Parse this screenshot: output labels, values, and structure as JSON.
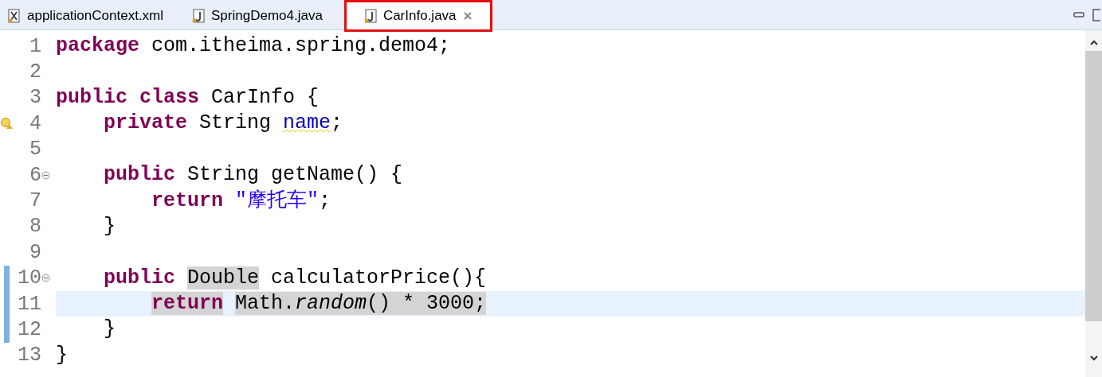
{
  "tabs": [
    {
      "label": "applicationContext.xml",
      "kind": "xml",
      "selected": false,
      "closable": false
    },
    {
      "label": "SpringDemo4.java",
      "kind": "java",
      "selected": false,
      "closable": false
    },
    {
      "label": "CarInfo.java",
      "kind": "java",
      "selected": true,
      "closable": true
    }
  ],
  "lines": [
    {
      "number": "1",
      "current": false,
      "changed": false,
      "warning": false,
      "foldable": false,
      "tokens": [
        {
          "kind": "keyword",
          "text": "package",
          "highlighted": false
        },
        {
          "kind": "plain",
          "text": " com.itheima.spring.demo4;",
          "highlighted": false
        }
      ]
    },
    {
      "number": "2",
      "current": false,
      "changed": false,
      "warning": false,
      "foldable": false
    },
    {
      "number": "3",
      "current": false,
      "changed": false,
      "warning": false,
      "foldable": false,
      "tokens": [
        {
          "kind": "keyword",
          "text": "public class",
          "highlighted": false
        },
        {
          "kind": "plain",
          "text": " CarInfo {",
          "highlighted": false
        }
      ]
    },
    {
      "number": "4",
      "current": false,
      "changed": false,
      "warning": true,
      "foldable": false,
      "tokens": [
        {
          "kind": "keyword",
          "text": "    private",
          "highlighted": false
        },
        {
          "kind": "plain",
          "text": " String ",
          "highlighted": false
        },
        {
          "kind": "field",
          "text": "name",
          "highlighted": false
        },
        {
          "kind": "plain",
          "text": ";",
          "highlighted": false
        }
      ]
    },
    {
      "number": "5",
      "current": false,
      "changed": false,
      "warning": false,
      "foldable": false
    },
    {
      "number": "6",
      "current": false,
      "changed": false,
      "warning": false,
      "foldable": true,
      "tokens": [
        {
          "kind": "keyword",
          "text": "    public",
          "highlighted": false
        },
        {
          "kind": "plain",
          "text": " String getName() {",
          "highlighted": false
        }
      ]
    },
    {
      "number": "7",
      "current": false,
      "changed": false,
      "warning": false,
      "foldable": false,
      "tokens": [
        {
          "kind": "keyword",
          "text": "        return",
          "highlighted": false
        },
        {
          "kind": "string",
          "text": " \"摩托车\"",
          "highlighted": false
        },
        {
          "kind": "plain",
          "text": ";",
          "highlighted": false
        }
      ]
    },
    {
      "number": "8",
      "current": false,
      "changed": false,
      "warning": false,
      "foldable": false,
      "tokens": [
        {
          "kind": "plain",
          "text": "    }",
          "highlighted": false
        }
      ]
    },
    {
      "number": "9",
      "current": false,
      "changed": false,
      "warning": false,
      "foldable": false
    },
    {
      "number": "10",
      "current": false,
      "changed": true,
      "warning": false,
      "foldable": true,
      "tokens": [
        {
          "kind": "keyword",
          "text": "    public",
          "highlighted": false
        },
        {
          "kind": "plain",
          "text": " Double",
          "highlighted": true
        },
        {
          "kind": "plain",
          "text": " calculatorPrice(){",
          "highlighted": false
        }
      ]
    },
    {
      "number": "11",
      "current": true,
      "changed": true,
      "warning": false,
      "foldable": false,
      "tokens": [
        {
          "kind": "keyword",
          "text": "        return",
          "highlighted": true
        },
        {
          "kind": "plain",
          "text": " Math.",
          "highlighted": true
        },
        {
          "kind": "italic",
          "text": "random",
          "highlighted": true
        },
        {
          "kind": "plain",
          "text": "() * 3000;",
          "highlighted": true
        }
      ]
    },
    {
      "number": "12",
      "current": false,
      "changed": true,
      "warning": false,
      "foldable": false,
      "tokens": [
        {
          "kind": "plain",
          "text": "    }",
          "highlighted": false
        }
      ]
    },
    {
      "number": "13",
      "current": false,
      "changed": false,
      "warning": false,
      "foldable": false,
      "tokens": [
        {
          "kind": "plain",
          "text": "}",
          "highlighted": false
        }
      ]
    }
  ]
}
